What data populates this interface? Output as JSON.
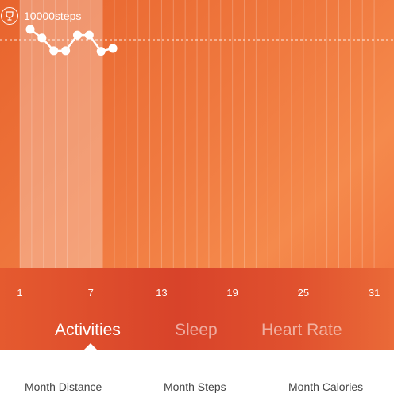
{
  "goal": {
    "label": "10000steps",
    "icon": "trophy-icon"
  },
  "chart_data": {
    "type": "line",
    "x_ticks": [
      "1",
      "7",
      "13",
      "19",
      "25",
      "31"
    ],
    "days_in_month": 31,
    "highlighted_days": [
      1,
      7
    ],
    "goal_value": 10000,
    "series": [
      {
        "days": [
          1,
          2,
          3,
          4,
          5,
          6,
          7,
          8
        ],
        "values": [
          11800,
          10300,
          8100,
          8100,
          10800,
          10800,
          8000,
          8500
        ]
      }
    ]
  },
  "tabs": [
    {
      "label": "Activities",
      "active": true
    },
    {
      "label": "Sleep",
      "active": false
    },
    {
      "label": "Heart Rate",
      "active": false
    }
  ],
  "stats": [
    {
      "label": "Month Distance"
    },
    {
      "label": "Month Steps"
    },
    {
      "label": "Month Calories"
    }
  ],
  "colors": {
    "accent": "#ef6a35",
    "accent_dark": "#d8432a"
  }
}
